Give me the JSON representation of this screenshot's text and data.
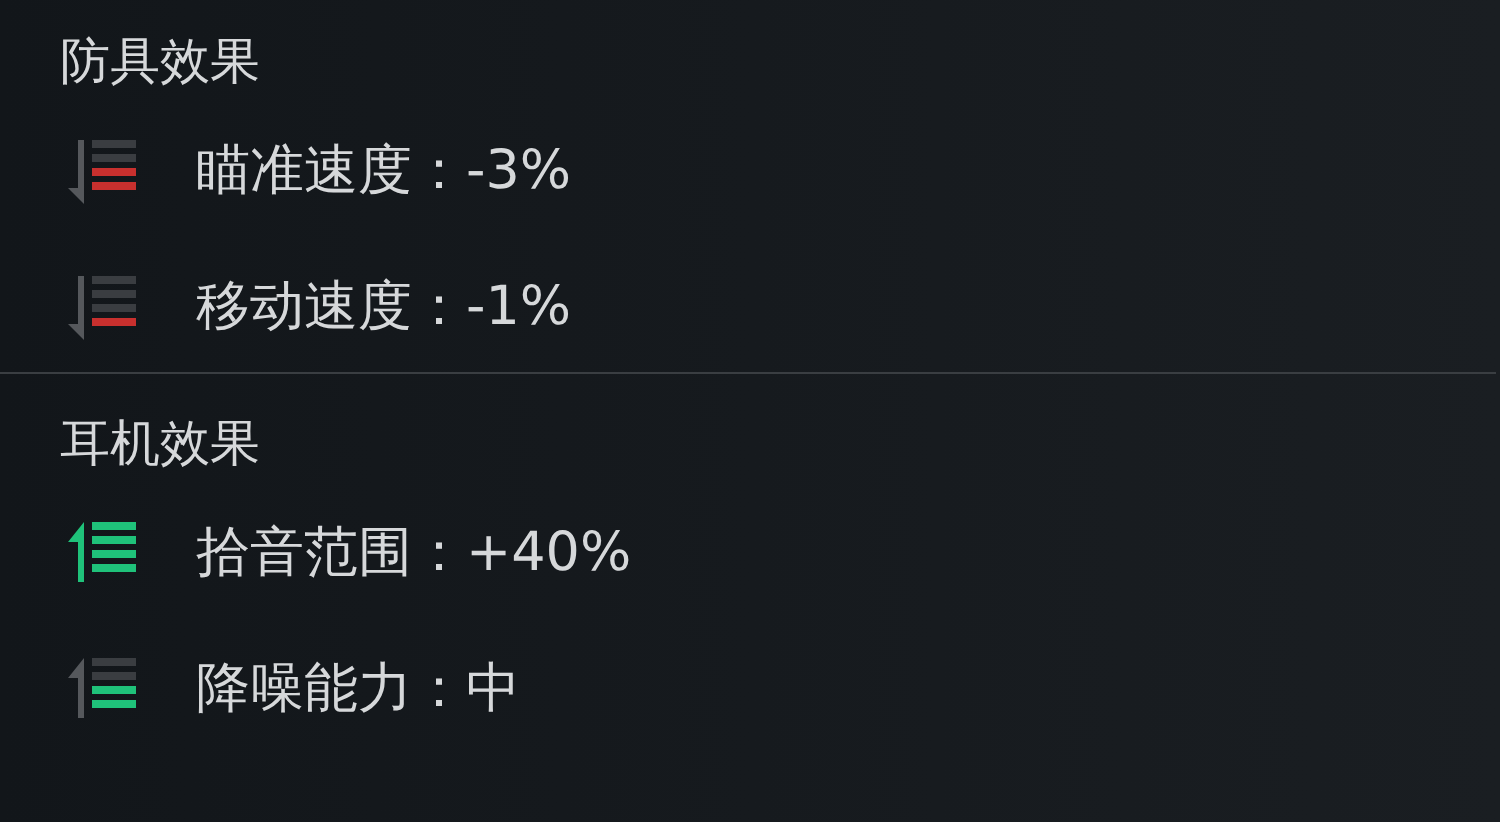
{
  "sections": [
    {
      "title": "防具效果",
      "effects": [
        {
          "kind": "decrease2",
          "label": "瞄准速度：-3%"
        },
        {
          "kind": "decrease1",
          "label": "移动速度：-1%"
        }
      ]
    },
    {
      "title": "耳机效果",
      "effects": [
        {
          "kind": "increase4",
          "label": "拾音范围：+40%"
        },
        {
          "kind": "increase2",
          "label": "降噪能力：中"
        }
      ]
    }
  ]
}
